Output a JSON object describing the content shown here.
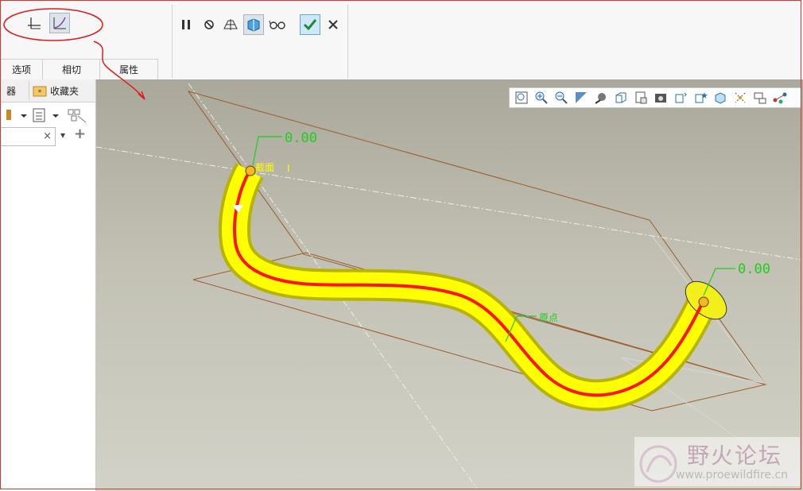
{
  "ribbon": {
    "tabs": [
      {
        "label": "选项"
      },
      {
        "label": "相切"
      },
      {
        "label": "属性"
      }
    ],
    "group1_icons": [
      "trajectory-normal-icon",
      "curve-icon"
    ],
    "group2_icons": [
      "pause-icon",
      "no-preview-icon",
      "attach-preview-icon",
      "solid-preview-icon",
      "verify-glasses-icon",
      "ok-check-icon",
      "cancel-x-icon"
    ]
  },
  "panel": {
    "tabs": [
      {
        "label": "器"
      },
      {
        "label": "收藏夹"
      }
    ],
    "search_value": "",
    "clear_label": "×",
    "add_label": "+"
  },
  "view_toolbar": {
    "icons": [
      "refit-icon",
      "zoom-in-icon",
      "zoom-out-icon",
      "repaint-icon",
      "display-style-icon",
      "saved-orientations-icon",
      "view-manager-icon",
      "perspective-icon",
      "datum-display-icon",
      "annotation-display-icon",
      "spin-center-icon",
      "plane-display-icon",
      "axis-display-icon",
      "point-display-icon"
    ]
  },
  "model": {
    "dim_start": "0.00",
    "dim_end": "0.00",
    "label_section": "截面",
    "label_section_mark": "I",
    "label_origin": "原点",
    "tube_color": "#ffff00",
    "trajectory_color": "#ff1414",
    "dim_color": "#22cc22"
  },
  "watermark": {
    "title": "野火论坛",
    "url": "www.proewildfire.cn"
  }
}
